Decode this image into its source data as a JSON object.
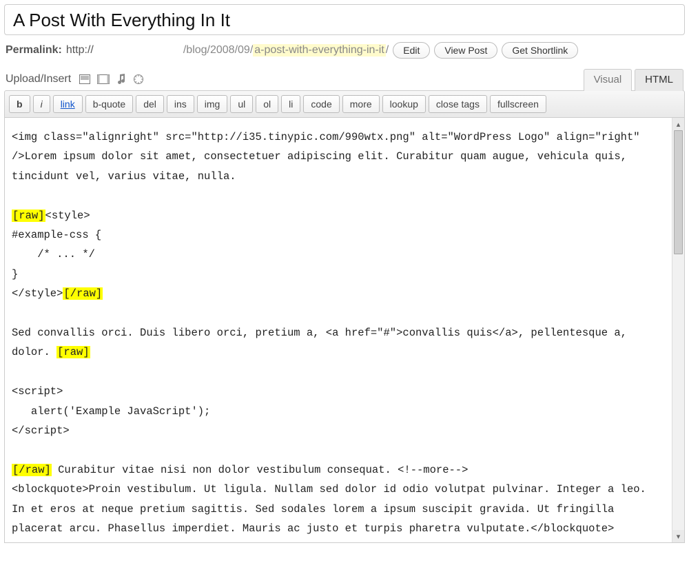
{
  "title": "A Post With Everything In It",
  "permalink": {
    "label": "Permalink:",
    "prefix": "http://",
    "path": "/blog/2008/09/",
    "slug": "a-post-with-everything-in-it",
    "trail": "/"
  },
  "buttons": {
    "edit": "Edit",
    "view_post": "View Post",
    "get_shortlink": "Get Shortlink"
  },
  "upload_label": "Upload/Insert",
  "tabs": {
    "visual": "Visual",
    "html": "HTML"
  },
  "toolbar": {
    "b": "b",
    "i": "i",
    "link": "link",
    "bquote": "b-quote",
    "del": "del",
    "ins": "ins",
    "img": "img",
    "ul": "ul",
    "ol": "ol",
    "li": "li",
    "code": "code",
    "more": "more",
    "lookup": "lookup",
    "closetags": "close tags",
    "fullscreen": "fullscreen"
  },
  "content": {
    "line1": "<img class=\"alignright\" src=\"http://i35.tinypic.com/990wtx.png\" alt=\"WordPress Logo\" align=\"right\" />Lorem ipsum dolor sit amet, consectetuer adipiscing elit. Curabitur quam augue, vehicula quis, tincidunt vel, varius vitae, nulla.",
    "raw_open": "[raw]",
    "style_open": "<style>",
    "style_body": "#example-css {\n    /* ... */\n}",
    "style_close": "</style>",
    "raw_close": "[/raw]",
    "line2a": "Sed convallis orci. Duis libero orci, pretium a, <a href=\"#\">convallis quis</a>, pellentesque a, dolor. ",
    "script_block": "<script>\n   alert('Example JavaScript');\n</script>",
    "line3a": " Curabitur vitae nisi non dolor vestibulum consequat. <!--more-->",
    "line3b": "<blockquote>Proin vestibulum. Ut ligula. Nullam sed dolor id odio volutpat pulvinar. Integer a leo. In et eros at neque pretium sagittis. Sed sodales lorem a ipsum suscipit gravida. Ut fringilla placerat arcu. Phasellus imperdiet. Mauris ac justo et turpis pharetra vulputate.</blockquote>"
  }
}
